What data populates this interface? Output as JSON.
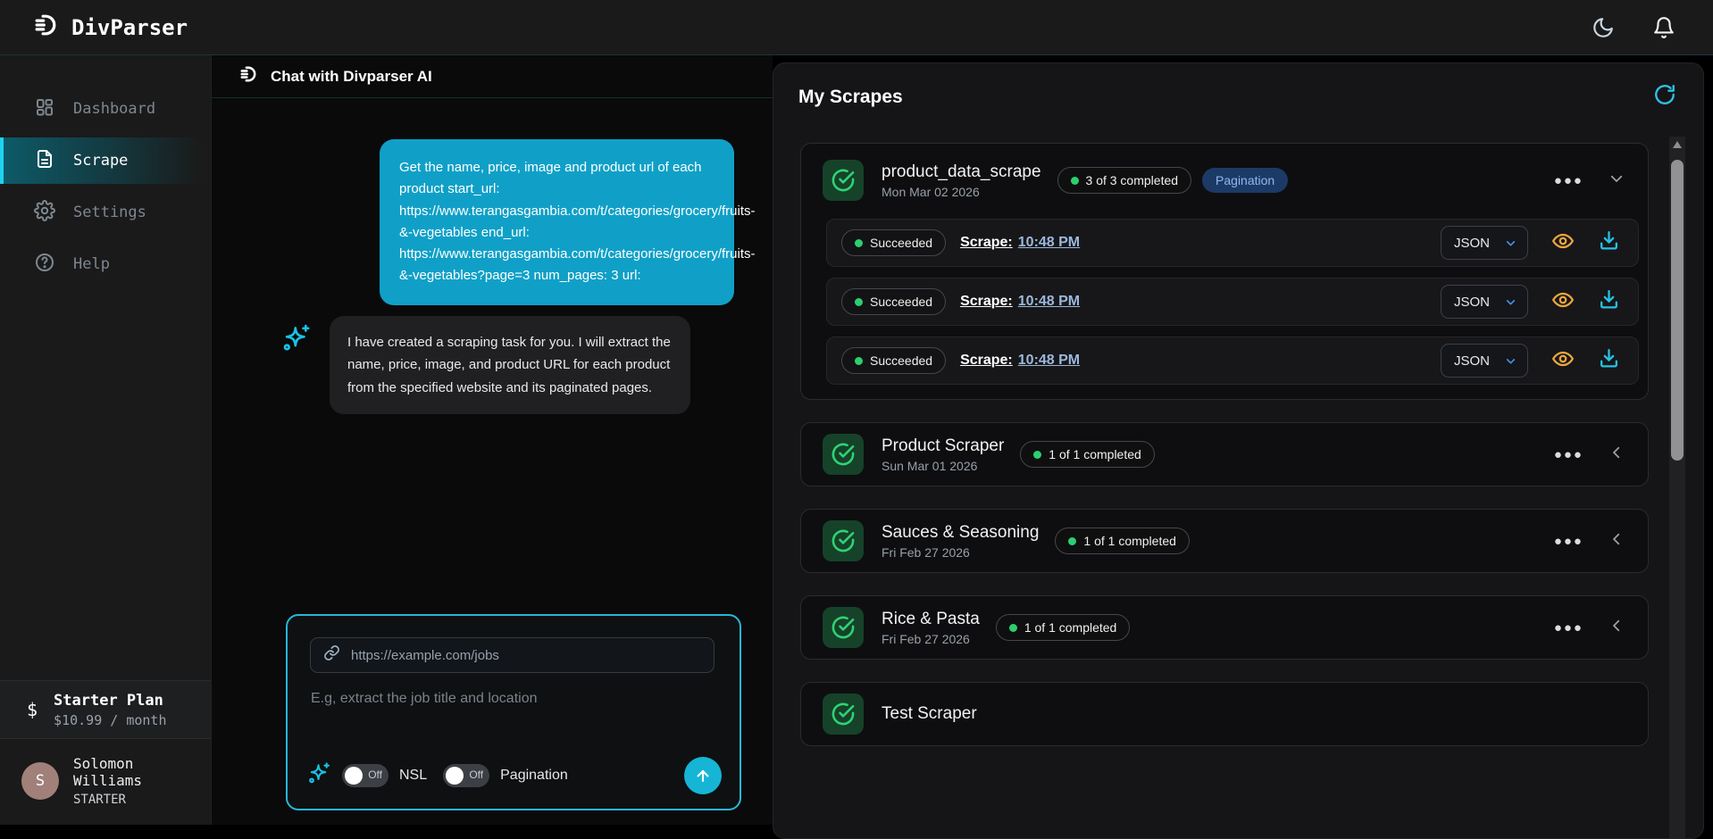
{
  "topbar": {
    "brand": "DivParser",
    "icons": [
      "moon-icon",
      "bell-icon"
    ]
  },
  "sidebar": {
    "items": [
      {
        "label": "Dashboard",
        "icon": "dashboard-grid-icon",
        "active": false
      },
      {
        "label": "Scrape",
        "icon": "document-icon",
        "active": true
      },
      {
        "label": "Settings",
        "icon": "gear-icon",
        "active": false
      },
      {
        "label": "Help",
        "icon": "question-circle-icon",
        "active": false
      }
    ],
    "plan": {
      "symbol": "$",
      "name": "Starter Plan",
      "price": "$10.99 / month"
    },
    "user": {
      "initial": "S",
      "name": "Solomon Williams",
      "tier": "STARTER"
    }
  },
  "chat": {
    "header": "Chat with Divparser AI",
    "user_message": "Get the name, price, image and product url of each product start_url: https://www.terangasgambia.com/t/categories/grocery/fruits-&-vegetables end_url: https://www.terangasgambia.com/t/categories/grocery/fruits-&-vegetables?page=3 num_pages: 3 url:",
    "ai_message": "I have created a scraping task for you. I will extract the name, price, image, and product URL for each product from the specified website and its paginated pages.",
    "input": {
      "url_placeholder": "https://example.com/jobs",
      "prompt_placeholder": "E.g, extract the job title and location",
      "toggles": [
        {
          "label": "NSL",
          "state": "Off",
          "on": false
        },
        {
          "label": "Pagination",
          "state": "Off",
          "on": false
        }
      ]
    }
  },
  "scrapes": {
    "title": "My Scrapes",
    "cards": [
      {
        "name": "product_data_scrape",
        "date": "Mon Mar 02 2026",
        "completed": "3 of 3 completed",
        "tag": "Pagination",
        "expanded": true,
        "runs": [
          {
            "status": "Succeeded",
            "label": "Scrape:",
            "time": "10:48 PM",
            "format": "JSON"
          },
          {
            "status": "Succeeded",
            "label": "Scrape:",
            "time": "10:48 PM",
            "format": "JSON"
          },
          {
            "status": "Succeeded",
            "label": "Scrape:",
            "time": "10:48 PM",
            "format": "JSON"
          }
        ]
      },
      {
        "name": "Product Scraper",
        "date": "Sun Mar 01 2026",
        "completed": "1 of 1 completed",
        "expanded": false
      },
      {
        "name": "Sauces & Seasoning",
        "date": "Fri Feb 27 2026",
        "completed": "1 of 1 completed",
        "expanded": false
      },
      {
        "name": "Rice & Pasta",
        "date": "Fri Feb 27 2026",
        "completed": "1 of 1 completed",
        "expanded": false
      },
      {
        "name": "Test Scraper",
        "partial": true
      }
    ]
  },
  "colors": {
    "accent_cyan": "#16b5d6",
    "bubble_cyan": "#10a0c7",
    "success_green": "#2bd06e",
    "eye_amber": "#eca63e",
    "time_blue": "#9cb8da",
    "tag_blue_bg": "#1c3a66",
    "tag_blue_text": "#8fb7ef"
  }
}
